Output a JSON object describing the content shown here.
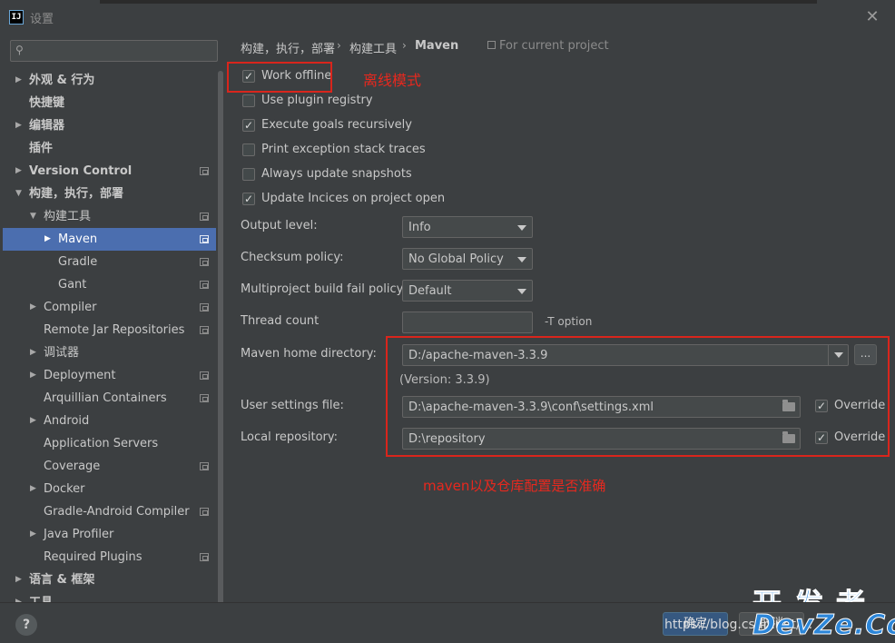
{
  "window": {
    "title": "设置",
    "app_icon": "IJ"
  },
  "search": {
    "value": "",
    "placeholder": ""
  },
  "sidebar": {
    "items": [
      {
        "label": "外观 & 行为",
        "expanded": false,
        "bold": true,
        "project_icon": false
      },
      {
        "label": "快捷键",
        "bold": true,
        "project_icon": false
      },
      {
        "label": "编辑器",
        "expanded": false,
        "bold": true,
        "project_icon": false
      },
      {
        "label": "插件",
        "bold": true,
        "project_icon": false
      },
      {
        "label": "Version Control",
        "expanded": false,
        "bold": true,
        "project_icon": true
      },
      {
        "label": "构建，执行，部署",
        "expanded": true,
        "bold": true,
        "project_icon": false
      },
      {
        "label": "构建工具",
        "expanded": true,
        "project_icon": true
      },
      {
        "label": "Maven",
        "expanded": false,
        "selected": true,
        "project_icon": true
      },
      {
        "label": "Gradle",
        "project_icon": true
      },
      {
        "label": "Gant",
        "project_icon": true
      },
      {
        "label": "Compiler",
        "expanded": false,
        "project_icon": true
      },
      {
        "label": "Remote Jar Repositories",
        "project_icon": true
      },
      {
        "label": "调试器",
        "expanded": false,
        "project_icon": false
      },
      {
        "label": "Deployment",
        "expanded": false,
        "project_icon": true
      },
      {
        "label": "Arquillian Containers",
        "project_icon": true
      },
      {
        "label": "Android",
        "expanded": false,
        "project_icon": false
      },
      {
        "label": "Application Servers",
        "project_icon": false
      },
      {
        "label": "Coverage",
        "project_icon": true
      },
      {
        "label": "Docker",
        "expanded": false,
        "project_icon": false
      },
      {
        "label": "Gradle-Android Compiler",
        "project_icon": true
      },
      {
        "label": "Java Profiler",
        "expanded": false,
        "project_icon": false
      },
      {
        "label": "Required Plugins",
        "project_icon": true
      },
      {
        "label": "语言 & 框架",
        "expanded": false,
        "bold": true,
        "project_icon": false
      },
      {
        "label": "工具",
        "expanded": false,
        "bold": true,
        "project_icon": false
      }
    ]
  },
  "breadcrumb": {
    "items": [
      "构建，执行，部署",
      "构建工具",
      "Maven"
    ],
    "separator": "›",
    "for_project": "For current project"
  },
  "checkboxes": [
    {
      "label": "Work offline",
      "checked": true
    },
    {
      "label": "Use plugin registry",
      "checked": false
    },
    {
      "label": "Execute goals recursively",
      "checked": true
    },
    {
      "label": "Print exception stack traces",
      "checked": false
    },
    {
      "label": "Always update snapshots",
      "checked": false
    },
    {
      "label": "Update Incices on project open",
      "checked": true
    }
  ],
  "form": {
    "output_level": {
      "label": "Output level:",
      "value": "Info"
    },
    "checksum_policy": {
      "label": "Checksum policy:",
      "value": "No Global Policy"
    },
    "multiproject": {
      "label": "Multiproject build fail policy:",
      "value": "Default"
    },
    "thread_count": {
      "label": "Thread count",
      "value": "",
      "suffix": "-T option"
    },
    "maven_home": {
      "label": "Maven home directory:",
      "value": "D:/apache-maven-3.3.9",
      "browse": "...",
      "version": "(Version: 3.3.9)"
    },
    "user_settings": {
      "label": "User settings file:",
      "value": "D:\\apache-maven-3.3.9\\conf\\settings.xml",
      "override_label": "Override",
      "override_checked": true
    },
    "local_repo": {
      "label": "Local repository:",
      "value": "D:\\repository",
      "override_label": "Override",
      "override_checked": true
    }
  },
  "annotations": {
    "offline_note": "离线模式",
    "config_note": "maven以及仓库配置是否准确"
  },
  "footer": {
    "help": "?",
    "ok": "确定",
    "cancel": "取消"
  },
  "watermark": {
    "url": "https://blog.csdn.net/...",
    "brand_top": "开发者",
    "brand_bottom": "DevZe.CoM"
  },
  "colors": {
    "background": "#3c3f41",
    "selection": "#4b6eaf",
    "annotation_red": "#d9251c",
    "watermark_blue": "#2c86d9"
  }
}
